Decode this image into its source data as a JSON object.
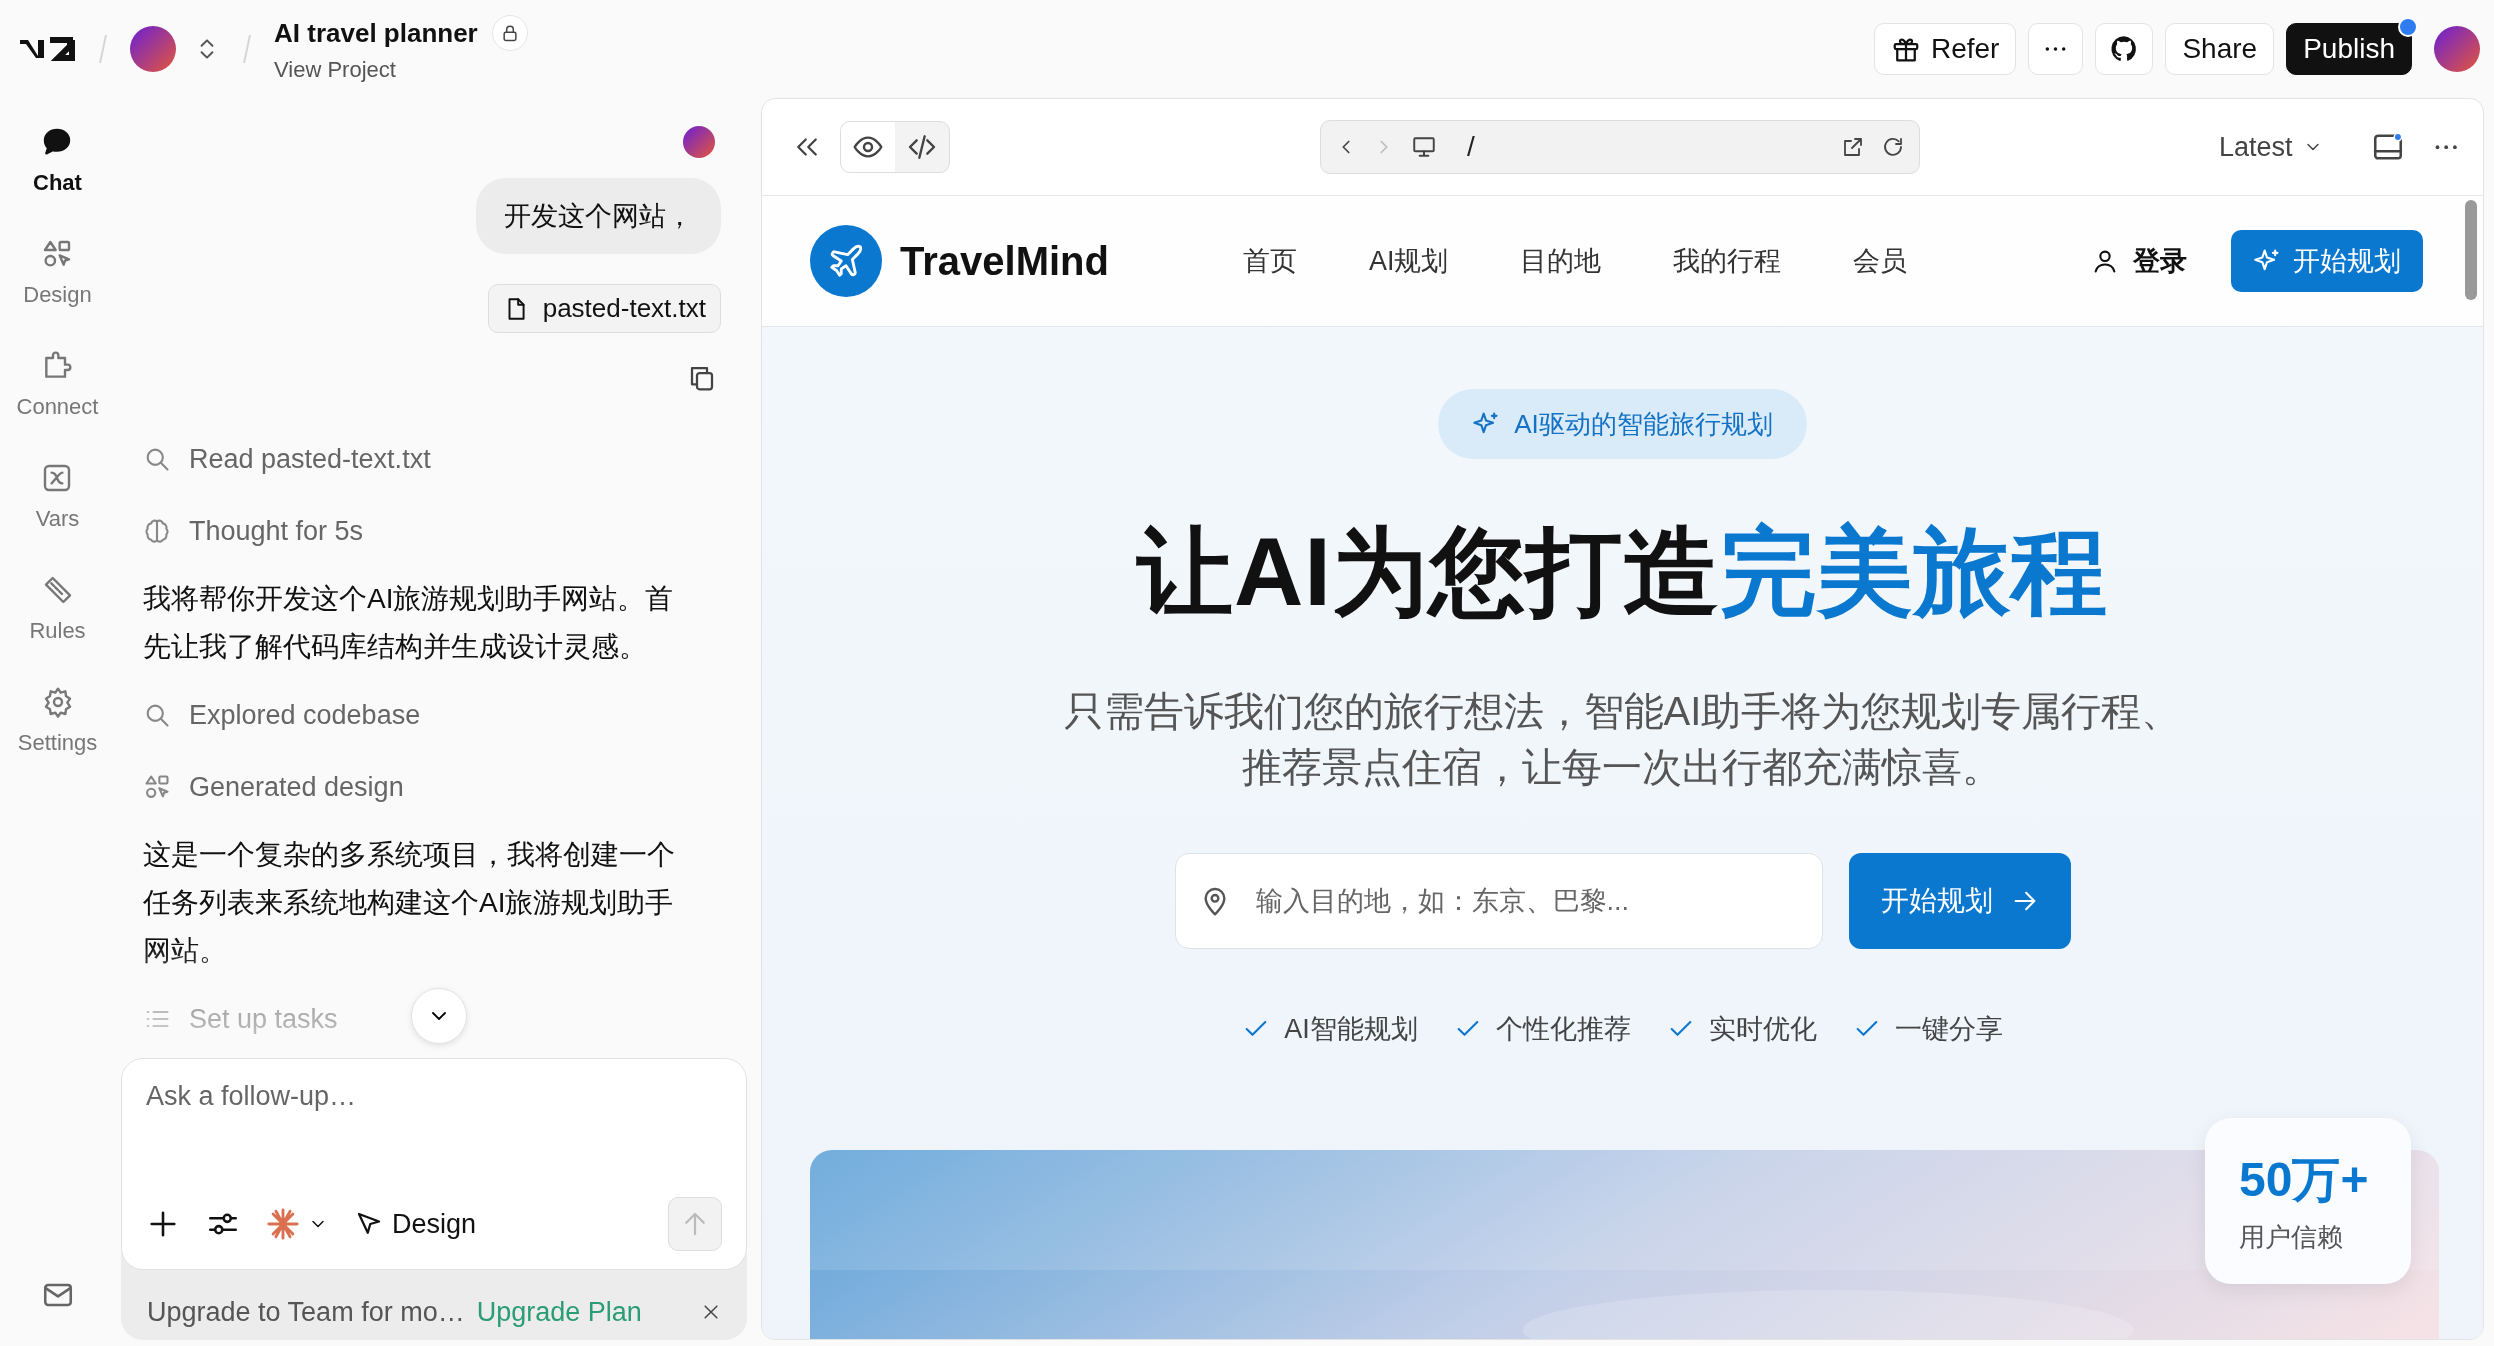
{
  "header": {
    "project_title": "AI travel planner",
    "project_link": "View Project",
    "actions": [
      {
        "kind": "gift",
        "label": "Refer"
      },
      {
        "kind": "more"
      },
      {
        "kind": "github"
      },
      {
        "kind": "plain",
        "label": "Share"
      },
      {
        "kind": "primary",
        "label": "Publish"
      }
    ]
  },
  "rail": {
    "items": [
      {
        "label": "Chat",
        "selected": true
      },
      {
        "label": "Design",
        "selected": false
      },
      {
        "label": "Connect",
        "selected": false
      },
      {
        "label": "Vars",
        "selected": false
      },
      {
        "label": "Rules",
        "selected": false
      },
      {
        "label": "Settings",
        "selected": false
      }
    ]
  },
  "chat": {
    "user_message": "开发这个网站，",
    "attachment": "pasted-text.txt",
    "entries": [
      {
        "kind": "read",
        "text": "Read pasted-text.txt"
      },
      {
        "kind": "think",
        "text": "Thought for 5s"
      },
      {
        "kind": "message",
        "text": "我将帮你开发这个AI旅游规划助手网站。首先让我了解代码库结构并生成设计灵感。"
      },
      {
        "kind": "explore",
        "text": "Explored codebase"
      },
      {
        "kind": "design",
        "text": "Generated design"
      },
      {
        "kind": "message",
        "text": "这是一个复杂的多系统项目，我将创建一个任务列表来系统地构建这个AI旅游规划助手网站。"
      },
      {
        "kind": "tasks",
        "text": "Set up tasks"
      }
    ]
  },
  "composer": {
    "placeholder": "Ask a follow-up…",
    "mode": "Design"
  },
  "upgrade": {
    "text": "Upgrade to Team for mo…",
    "link": "Upgrade Plan"
  },
  "preview": {
    "url": "/",
    "version": "Latest",
    "site": {
      "brand": "TravelMind",
      "nav": [
        "首页",
        "AI规划",
        "目的地",
        "我的行程",
        "会员"
      ],
      "login": "登录",
      "cta": "开始规划",
      "badge": "AI驱动的智能旅行规划",
      "title": "让AI为您打造",
      "title_highlight": "完美旅程",
      "subtitle_lines": [
        "只需告诉我们您的旅行想法，智能AI助手将为您规划专属行程、",
        "推荐景点住宿，让每一次出行都充满惊喜。"
      ],
      "search_placeholder": "输入目的地，如：东京、巴黎...",
      "search_button": "开始规划",
      "features": [
        "AI智能规划",
        "个性化推荐",
        "实时优化",
        "一键分享"
      ],
      "stat": {
        "value": "50万+",
        "label": "用户信赖"
      }
    }
  }
}
